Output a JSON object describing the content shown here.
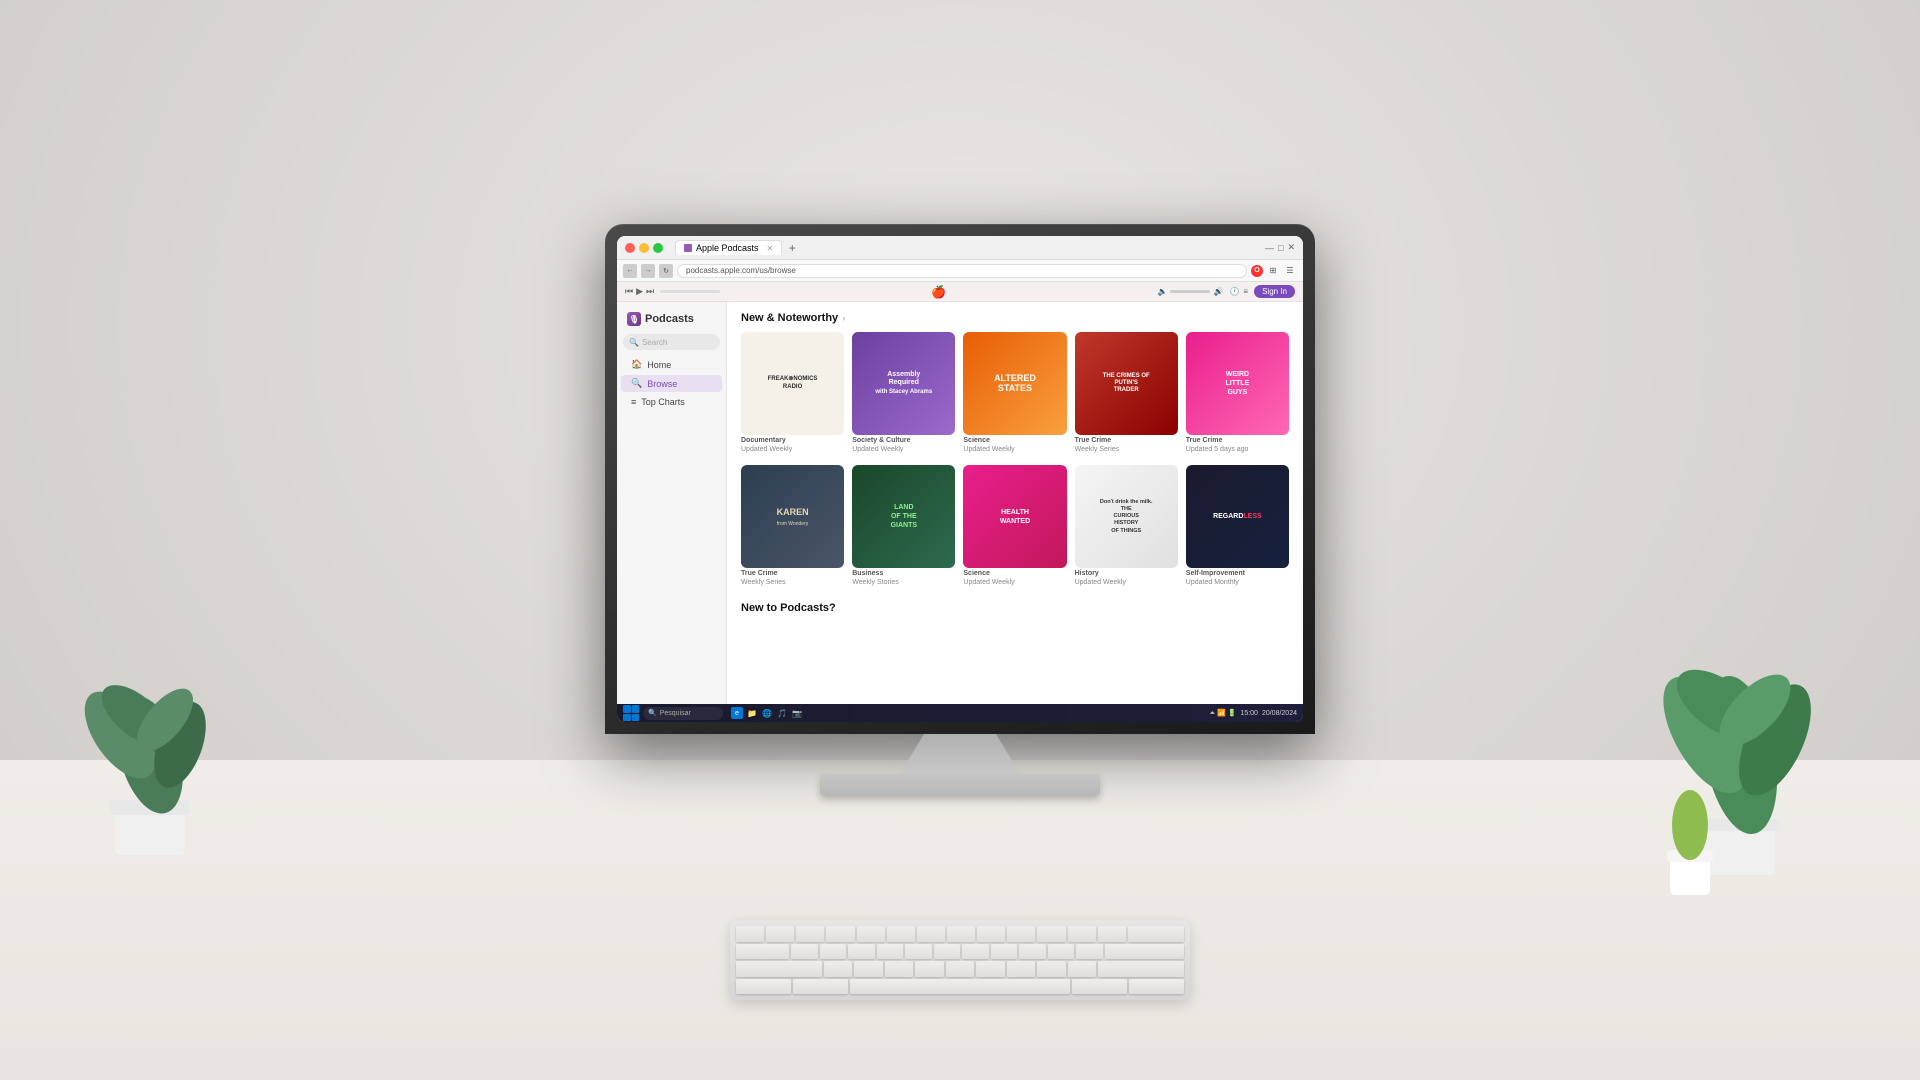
{
  "background": {
    "gradient_start": "#e8e5e2",
    "gradient_end": "#ccc9c6"
  },
  "browser": {
    "title": "Apple Podcasts",
    "url": "podcasts.apple.com/us/browse",
    "tabs": [
      {
        "label": "Apple Podcasts",
        "active": true
      }
    ],
    "nav": {
      "back": "←",
      "forward": "→",
      "refresh": "↻"
    },
    "sign_in_label": "Sign In"
  },
  "podcasts_app": {
    "logo": "Podcasts",
    "search_placeholder": "Search",
    "sidebar": [
      {
        "id": "home",
        "label": "Home",
        "icon": "🏠"
      },
      {
        "id": "browse",
        "label": "Browse",
        "icon": "🔍",
        "active": true
      },
      {
        "id": "top-charts",
        "label": "Top Charts",
        "icon": "≡"
      }
    ],
    "sections": [
      {
        "id": "new-noteworthy",
        "title": "New & Noteworthy",
        "has_arrow": true,
        "podcasts": [
          {
            "id": "freakonomics",
            "title": "Freakonomics Radio",
            "category": "Documentary",
            "update_freq": "Updated Weekly",
            "art_style": "freakonomics",
            "art_text": "FREAK⊗NOMICS RADIO"
          },
          {
            "id": "assembly",
            "title": "Assembly Required",
            "category": "Society & Culture",
            "update_freq": "Updated Weekly",
            "art_style": "assembly",
            "art_text": "Assembly Required"
          },
          {
            "id": "altered-states",
            "title": "Altered States",
            "category": "Science",
            "update_freq": "Updated Weekly",
            "art_style": "altered",
            "art_text": "ALTERED STATES"
          },
          {
            "id": "putins-trader",
            "title": "The Crimes of Putin's Trader",
            "category": "True Crime",
            "update_freq": "Weekly Series",
            "art_style": "putins",
            "art_text": "THE CRIMES OF PUTIN'S TRADER"
          },
          {
            "id": "weird-little-guys",
            "title": "Weird Little Guys",
            "category": "True Crime",
            "update_freq": "Updated 5 days ago",
            "art_style": "weird",
            "art_text": "WEIRD LITTLE GUYS"
          }
        ]
      },
      {
        "id": "row2",
        "title": "",
        "has_arrow": false,
        "podcasts": [
          {
            "id": "karen",
            "title": "Karen",
            "category": "True Crime",
            "update_freq": "Weekly Series",
            "art_style": "karen",
            "art_text": "KAREN"
          },
          {
            "id": "land-giants",
            "title": "Land of the Giants",
            "category": "Business",
            "update_freq": "Weekly Stories",
            "art_style": "land",
            "art_text": "LAND OF THE GIANTS"
          },
          {
            "id": "health-wanted",
            "title": "Health Wanted",
            "category": "Science",
            "update_freq": "Updated Weekly",
            "art_style": "health",
            "art_text": "HEALTH WANTED"
          },
          {
            "id": "curious-history",
            "title": "The Curious History of Things",
            "category": "History",
            "update_freq": "Updated Weekly",
            "art_style": "curious",
            "art_text": "Don't drink the milk. THE CURIOUS HISTORY OF THINGS"
          },
          {
            "id": "regardless",
            "title": "Regardless",
            "category": "Self-Improvement",
            "update_freq": "Updated Monthly",
            "art_style": "regardless",
            "art_text": "REGARDLESS"
          }
        ]
      }
    ],
    "new_to_podcasts": "New to Podcasts?"
  },
  "taskbar": {
    "search_placeholder": "Pesquisar",
    "time": "15:00",
    "date": "20/08/2024"
  }
}
